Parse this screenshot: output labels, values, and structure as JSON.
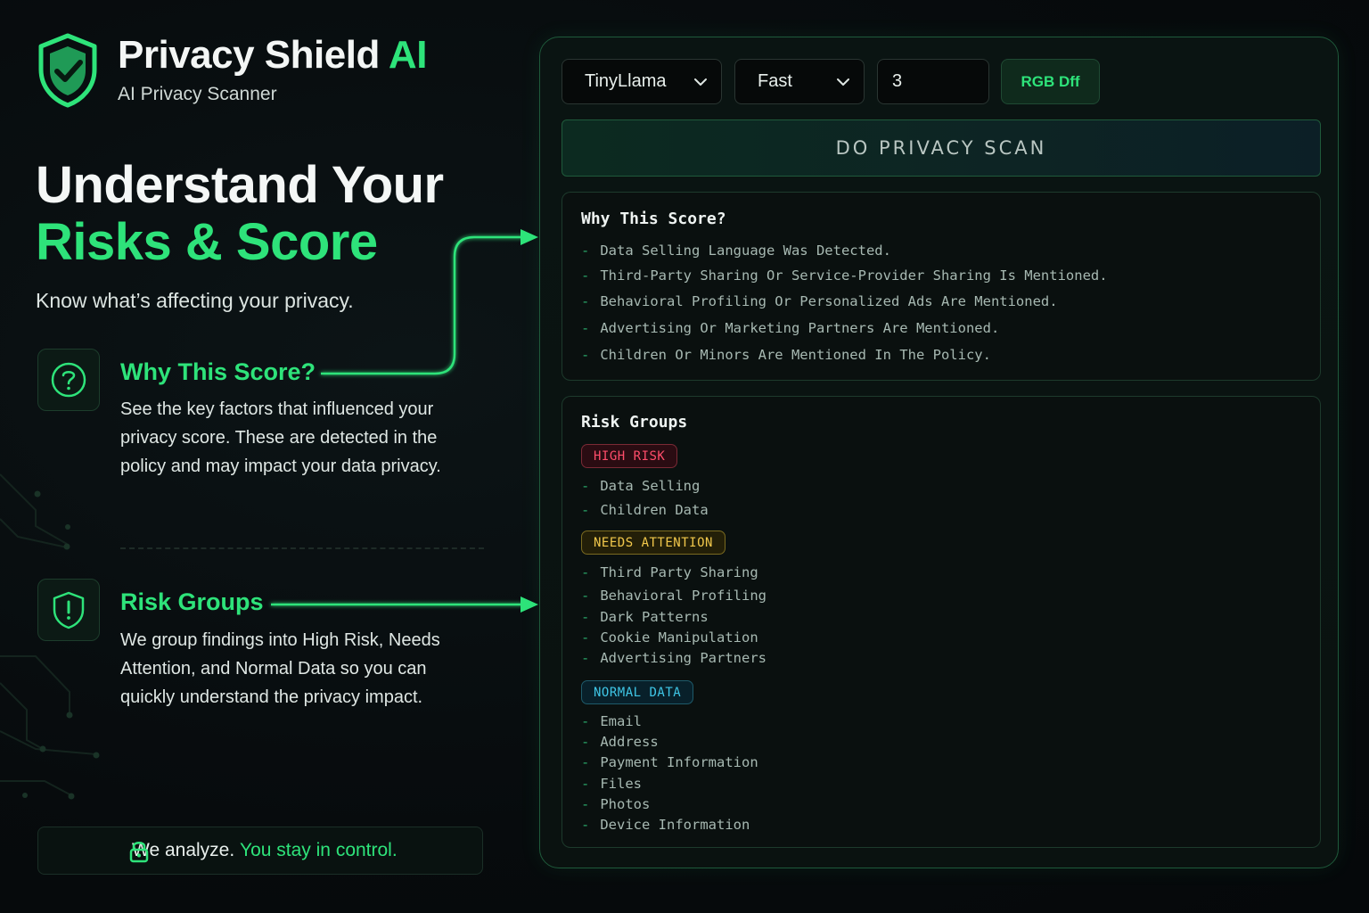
{
  "brand": {
    "title_main": "Privacy Shield",
    "title_accent": "AI",
    "subtitle": "AI Privacy Scanner"
  },
  "hero": {
    "line1": "Understand Your",
    "line2": "Risks & Score",
    "tagline": "Know what’s affecting your privacy."
  },
  "features": {
    "why": {
      "title": "Why This Score?",
      "description": "See the key factors that influenced your privacy score. These are detected in the policy and may impact your data privacy."
    },
    "groups": {
      "title": "Risk Groups",
      "description": "We group findings into High Risk, Needs Attention, and Normal Data so you can quickly understand the privacy impact."
    }
  },
  "footer": {
    "text_plain": "We analyze.",
    "text_accent": "You stay in control."
  },
  "controls": {
    "model_select": "TinyLlama",
    "speed_select": "Fast",
    "count_input": "3",
    "rgb_button": "RGB Dff",
    "scan_button": "DO PRIVACY SCAN"
  },
  "why_card": {
    "title": "Why This Score?",
    "items": [
      "Data Selling Language Was Detected.",
      "Third-Party Sharing Or Service-Provider Sharing Is Mentioned.",
      "Behavioral Profiling Or Personalized Ads Are Mentioned.",
      "Advertising Or Marketing Partners Are Mentioned.",
      "Children Or Minors Are Mentioned In The Policy."
    ]
  },
  "groups_card": {
    "title": "Risk Groups",
    "high": {
      "label": "HIGH RISK",
      "items": [
        "Data Selling",
        "Children Data"
      ]
    },
    "attention": {
      "label": "NEEDS ATTENTION",
      "items": [
        "Third Party Sharing",
        "Behavioral Profiling",
        "Dark Patterns",
        "Cookie Manipulation",
        "Advertising Partners"
      ]
    },
    "normal": {
      "label": "NORMAL DATA",
      "items": [
        "Email",
        "Address",
        "Payment Information",
        "Files",
        "Photos",
        "Device Information"
      ]
    }
  },
  "colors": {
    "accent": "#2ee37a",
    "high_risk": "#ff4d6a",
    "attention": "#f2c84b",
    "normal": "#3fc6e6"
  },
  "icons": [
    "shield-check-icon",
    "question-circle-icon",
    "shield-alert-icon",
    "lock-icon",
    "chevron-down-icon"
  ]
}
